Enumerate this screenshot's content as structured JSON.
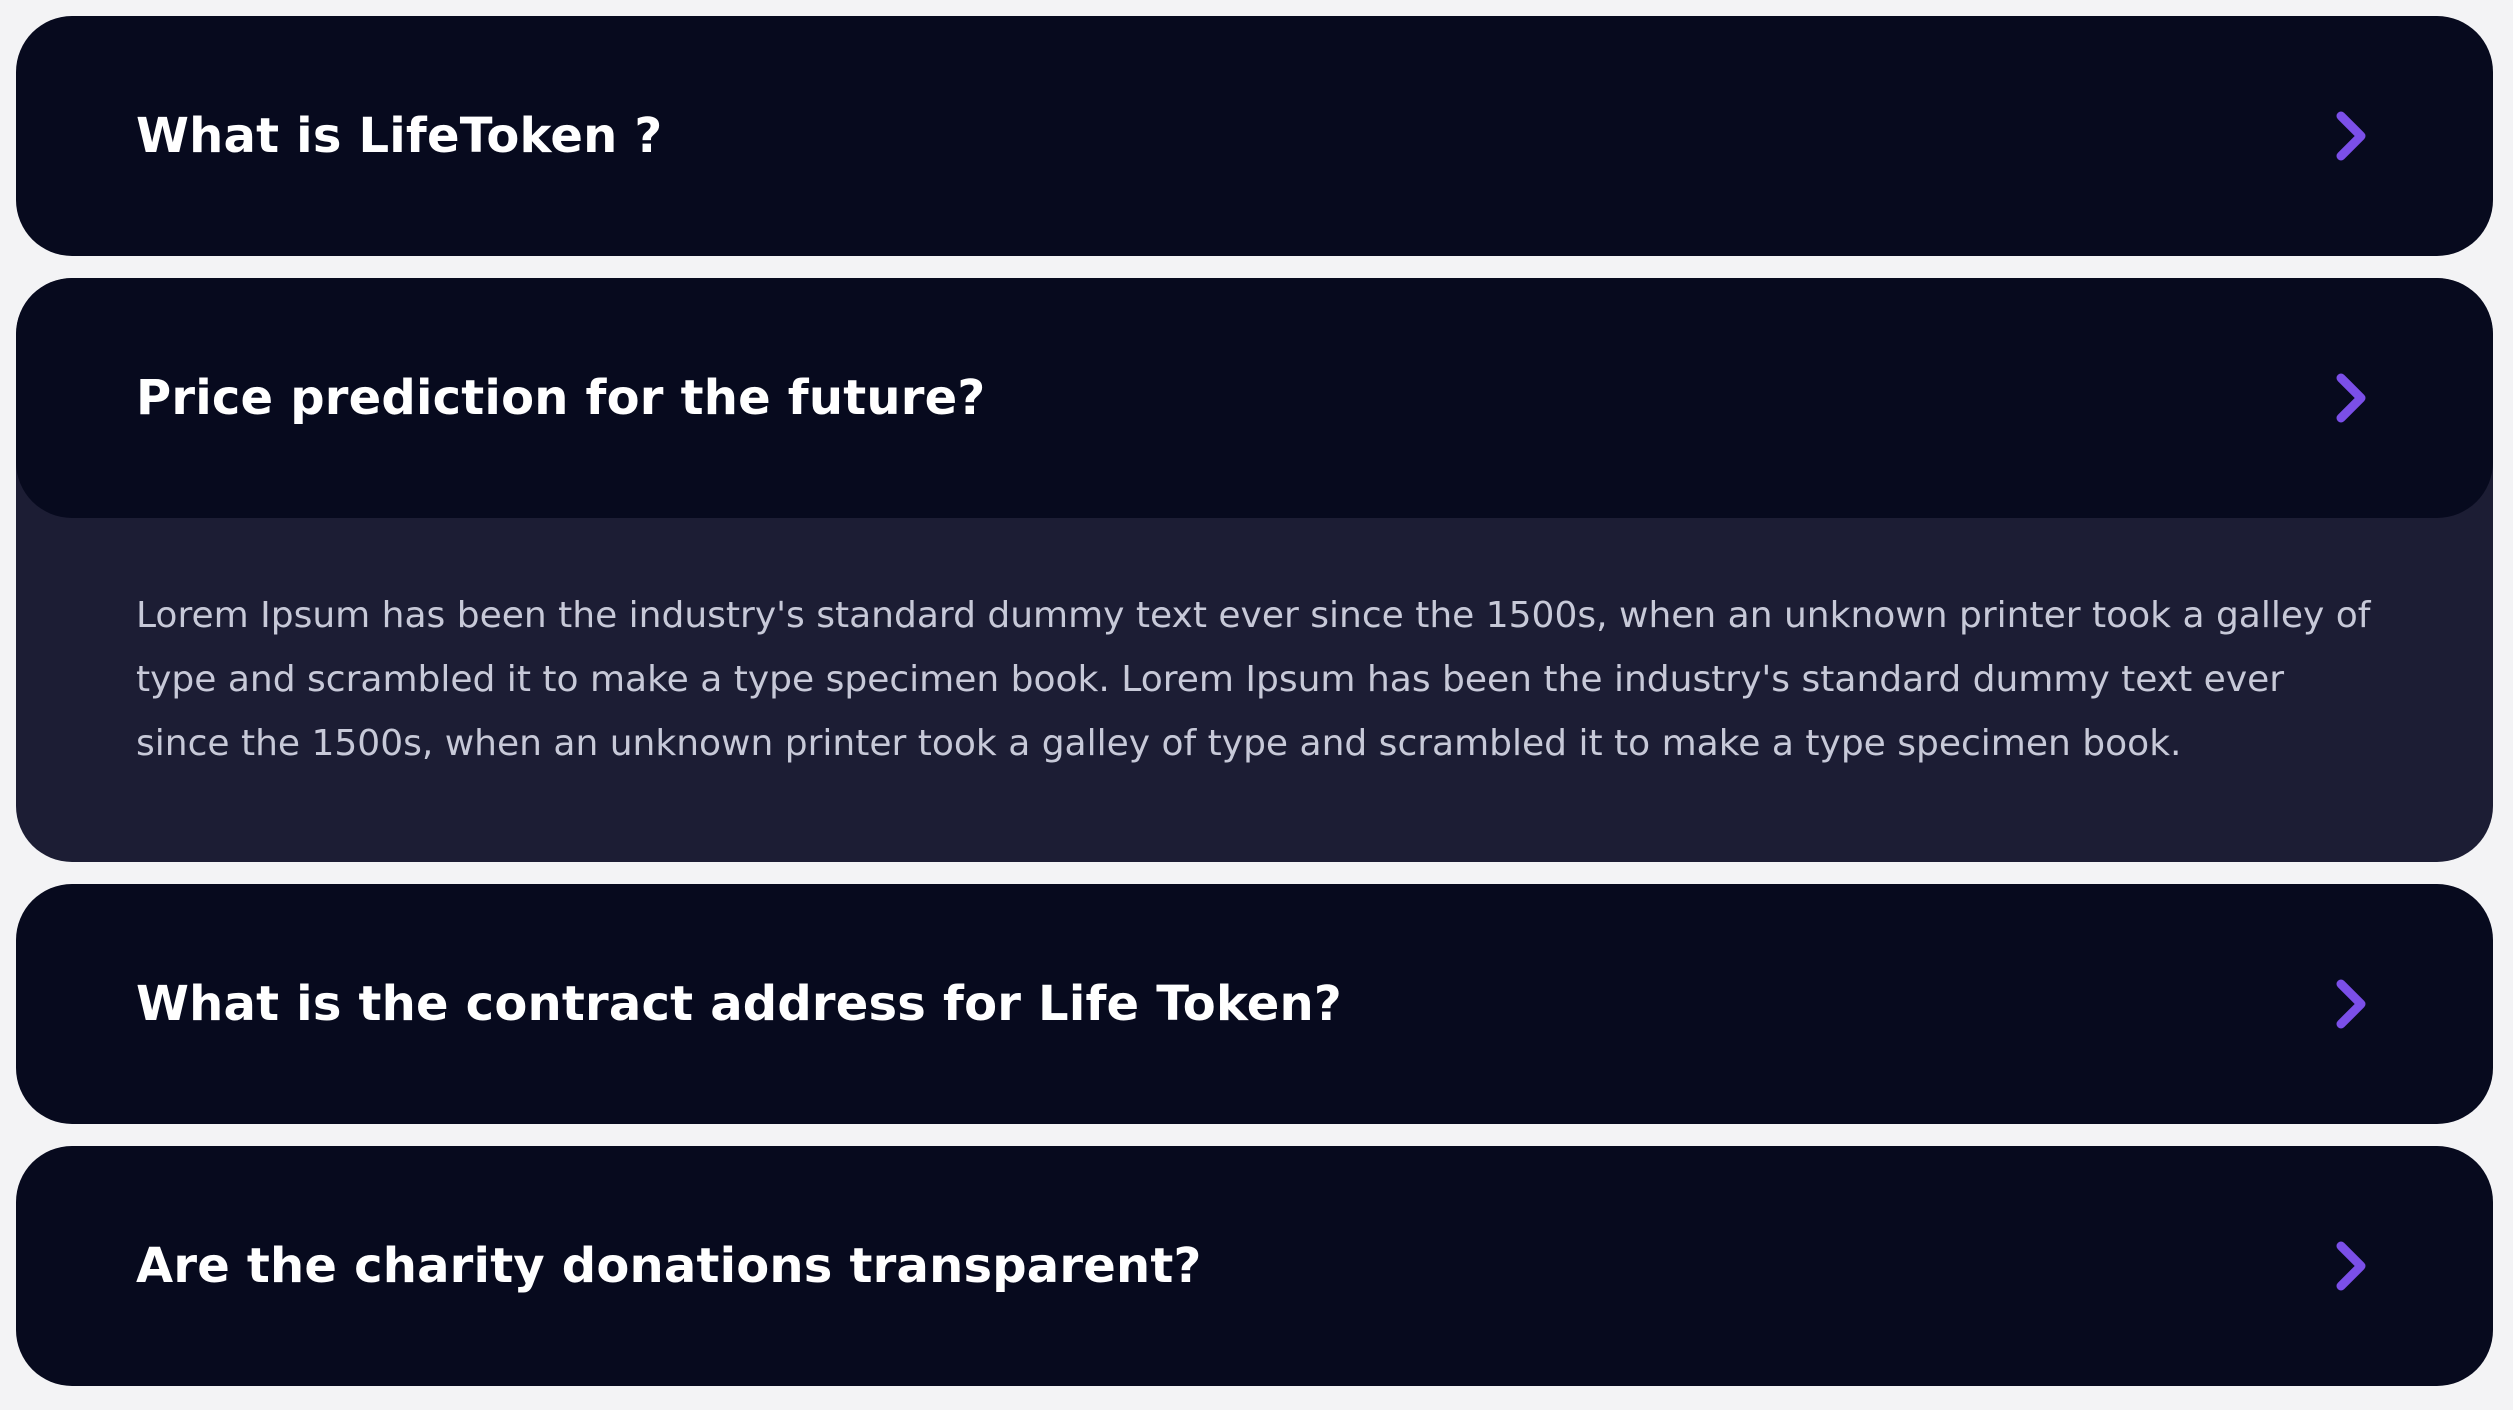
{
  "faq": {
    "items": [
      {
        "question": "What is LifeToken ?",
        "expanded": false
      },
      {
        "question": "Price prediction for the future?",
        "expanded": true,
        "answer": "Lorem Ipsum has been the industry's standard dummy text ever since the 1500s, when an unknown printer took a galley of type and scrambled it to make a type specimen book. Lorem Ipsum has been the industry's standard dummy text ever since the 1500s, when an unknown printer took a galley of type and scrambled it to make a type specimen book."
      },
      {
        "question": "What is the contract address for Life Token?",
        "expanded": false
      },
      {
        "question": "Are the charity donations transparent?",
        "expanded": false
      }
    ]
  },
  "icons": {
    "expand": "chevron-right-icon"
  },
  "colors": {
    "page_background": "#f3f3f5",
    "card_background": "#070a1e",
    "answer_background": "#1c1d34",
    "accent": "#7b4fe8",
    "question_text": "#ffffff",
    "answer_text": "#c7c9d8"
  }
}
